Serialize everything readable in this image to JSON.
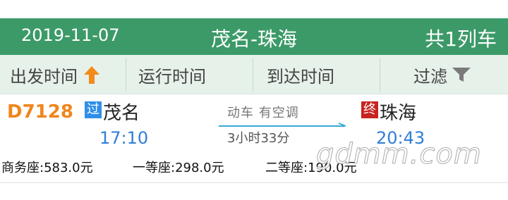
{
  "header": {
    "date": "2019-11-07",
    "route": "茂名-珠海",
    "count": "共1列车",
    "bg_color": "#3c9a68"
  },
  "sortbar": {
    "items": [
      {
        "label": "出发时间",
        "icon": "arrow-up-icon"
      },
      {
        "label": "运行时间"
      },
      {
        "label": "到达时间"
      },
      {
        "label": "过滤",
        "icon": "filter-icon"
      }
    ]
  },
  "train": {
    "number": "D7128",
    "from_badge": "过",
    "from_station": "茂名",
    "departure": "17:10",
    "type_text": "动车  有空调",
    "duration": "3小时33分",
    "to_badge": "终",
    "to_station": "珠海",
    "arrival": "20:43",
    "seats": [
      {
        "text": "商务座:583.0元"
      },
      {
        "text": "一等座:298.0元"
      },
      {
        "text": "二等座:190.0元"
      }
    ],
    "accent_color": "#f0861d",
    "time_color": "#2f7ed8"
  },
  "watermark": "gdmm.com"
}
